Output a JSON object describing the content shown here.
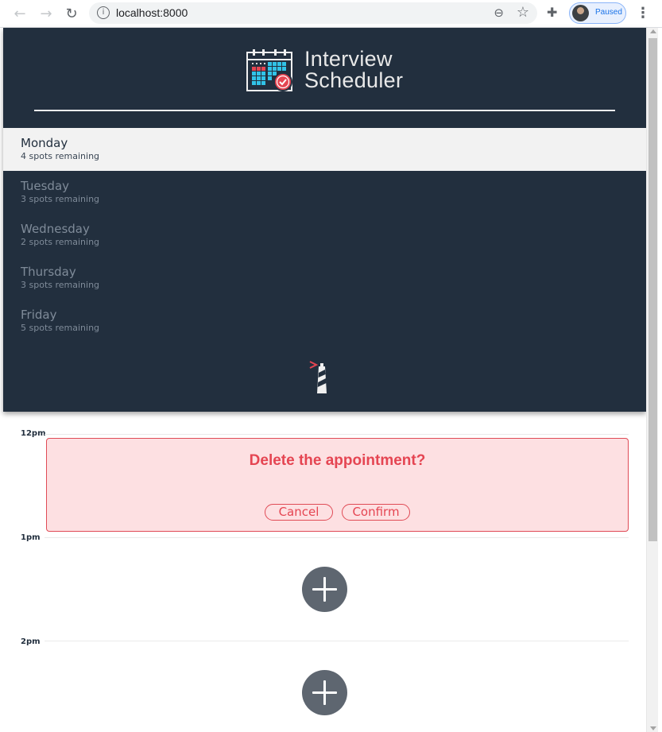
{
  "browser": {
    "url": "localhost:8000",
    "profile_status": "Paused"
  },
  "app": {
    "title_line1": "Interview",
    "title_line2": "Scheduler"
  },
  "days": [
    {
      "name": "Monday",
      "spots": "4 spots remaining",
      "selected": true
    },
    {
      "name": "Tuesday",
      "spots": "3 spots remaining",
      "selected": false
    },
    {
      "name": "Wednesday",
      "spots": "2 spots remaining",
      "selected": false
    },
    {
      "name": "Thursday",
      "spots": "3 spots remaining",
      "selected": false
    },
    {
      "name": "Friday",
      "spots": "5 spots remaining",
      "selected": false
    }
  ],
  "schedule": {
    "slots": [
      "12pm",
      "1pm",
      "2pm"
    ],
    "confirm": {
      "message": "Delete the appointment?",
      "cancel_label": "Cancel",
      "confirm_label": "Confirm"
    }
  },
  "colors": {
    "sidebar_bg": "#222f3e",
    "danger": "#e54552",
    "danger_bg": "#fde0e2"
  }
}
